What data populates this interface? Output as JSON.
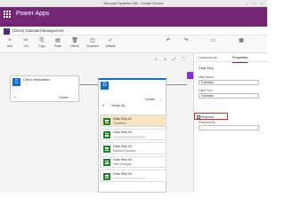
{
  "window": {
    "title": "Microsoft Dynamics 365 - Google Chrome"
  },
  "app_header": {
    "brand": "Power Apps"
  },
  "path_bar": {
    "path_text": "(Client) Standard Management: ..."
  },
  "toolbar": {
    "buttons": [
      {
        "label": "Add",
        "icon": "plus-icon"
      },
      {
        "label": "Cut",
        "icon": "cut-icon"
      },
      {
        "label": "Copy",
        "icon": "copy-icon"
      },
      {
        "label": "Paste",
        "icon": "paste-icon"
      },
      {
        "label": "Delete",
        "icon": "delete-icon"
      },
      {
        "label": "Snapshot",
        "icon": "snapshot-icon"
      },
      {
        "label": "Validate",
        "icon": "validate-icon"
      }
    ],
    "right_icons": [
      "undo-icon",
      "redo-icon",
      "ribbon-icon",
      "save-icon"
    ]
  },
  "canvas": {
    "tools": [
      "zoom-in-icon",
      "zoom-out-icon",
      "fit-icon",
      "expand-icon"
    ],
    "stage_left": {
      "name": "Client Information",
      "count": "1",
      "details_label": "Details"
    },
    "stage_center": {
      "badge": "D",
      "name": "Steps (4)",
      "details_label": "Details"
    },
    "steps": [
      {
        "title": "Data Step #1",
        "subtitle": "Transition",
        "selected": true
      },
      {
        "title": "Data Step #2",
        "subtitle": "",
        "selected": false
      },
      {
        "title": "Data Step #3",
        "subtitle": "Needed Services",
        "selected": false
      },
      {
        "title": "Data Step #4",
        "subtitle": "Fee Changes",
        "selected": false
      },
      {
        "title": "Data Step #5",
        "subtitle": "",
        "selected": false
      }
    ]
  },
  "properties_panel": {
    "tabs": [
      "Components",
      "Properties"
    ],
    "active_tab": "Properties",
    "heading": "Data Step",
    "step_name_label": "Step Name",
    "step_name_value": "Transition",
    "data_field_label": "Data Field",
    "data_field_value": "Transition",
    "required_label": "Required",
    "required_checked": false,
    "bottom_label": "Required By",
    "bottom_value": "--"
  },
  "colors": {
    "app_header": "#742774",
    "stage_badge": "#0f6fc6",
    "step_icon": "#217e2a",
    "selected_step": "#f6e4c2",
    "highlight_border": "#d12a2a"
  }
}
